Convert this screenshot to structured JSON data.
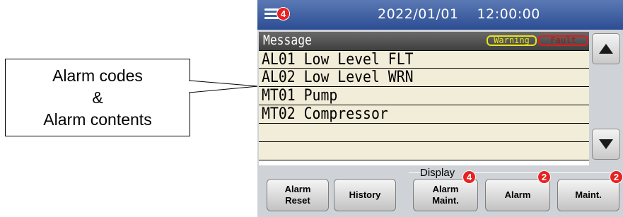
{
  "callout": {
    "line1": "Alarm codes",
    "line2": "&",
    "line3": "Alarm contents"
  },
  "header": {
    "menu_icon": "hamburger-menu-icon",
    "menu_badge": "4",
    "date": "2022/01/01",
    "time": "12:00:00"
  },
  "messages": {
    "title": "Message",
    "warning_label": "Warning",
    "fault_label": "Fault",
    "rows": [
      "AL01 Low Level FLT",
      "AL02 Low Level WRN",
      "MT01 Pump",
      "MT02 Compressor",
      "",
      ""
    ]
  },
  "scroll": {
    "up_icon": "triangle-up-icon",
    "down_icon": "triangle-down-icon"
  },
  "bottom": {
    "display_label": "Display",
    "buttons": {
      "alarm_reset_line1": "Alarm",
      "alarm_reset_line2": "Reset",
      "history": "History",
      "alarm_maint_line1": "Alarm",
      "alarm_maint_line2": "Maint.",
      "alarm": "Alarm",
      "maint": "Maint."
    },
    "badges": {
      "alarm_maint": "4",
      "alarm": "2",
      "maint": "2"
    }
  },
  "colors": {
    "topbar": "#2c4d93",
    "badge": "#e52322",
    "row_bg": "#f2edd9",
    "warning": "#e8e41a",
    "fault": "#e01c1c"
  }
}
